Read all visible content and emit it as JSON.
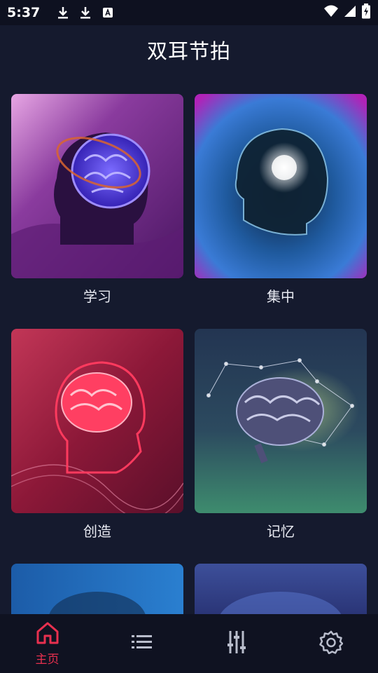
{
  "status_bar": {
    "time": "5:37"
  },
  "app": {
    "title": "双耳节拍"
  },
  "categories": [
    {
      "label": "学习"
    },
    {
      "label": "集中"
    },
    {
      "label": "创造"
    },
    {
      "label": "记忆"
    }
  ],
  "bottom_nav": {
    "items": [
      {
        "label": "主页",
        "icon": "home-icon",
        "active": true
      },
      {
        "label": "",
        "icon": "list-icon",
        "active": false
      },
      {
        "label": "",
        "icon": "equalizer-icon",
        "active": false
      },
      {
        "label": "",
        "icon": "settings-gear-icon",
        "active": false
      }
    ],
    "active_color": "#e8304f",
    "inactive_color": "#b9bdcc"
  }
}
